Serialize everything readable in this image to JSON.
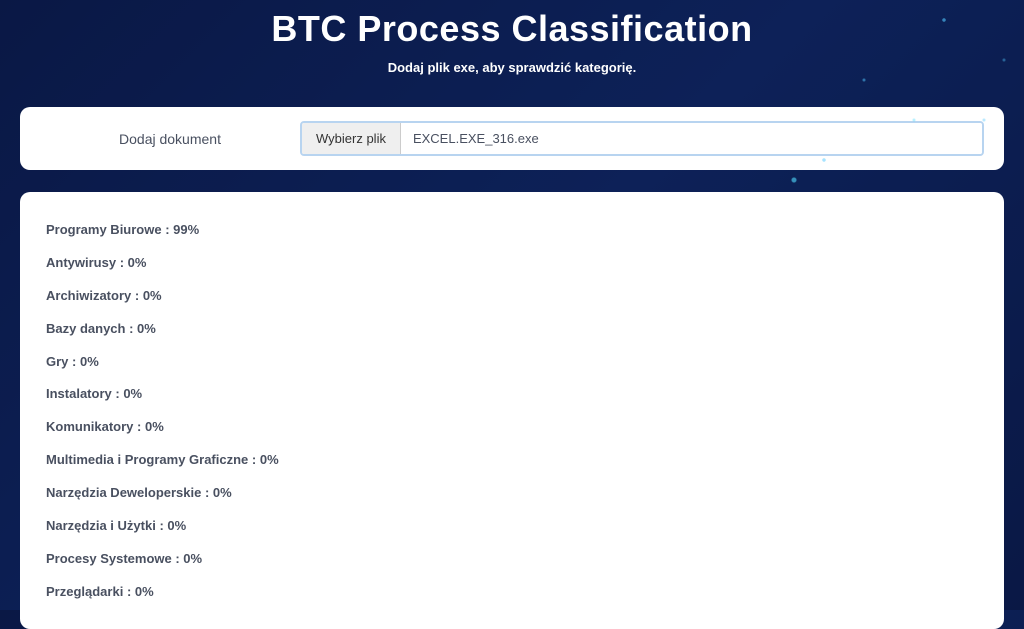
{
  "header": {
    "title": "BTC Process Classification",
    "subtitle": "Dodaj plik exe, aby sprawdzić kategorię."
  },
  "upload": {
    "label": "Dodaj dokument",
    "button": "Wybierz plik",
    "filename": "EXCEL.EXE_316.exe"
  },
  "results": [
    {
      "category": "Programy Biurowe",
      "percent": "99%"
    },
    {
      "category": "Antywirusy",
      "percent": "0%"
    },
    {
      "category": "Archiwizatory",
      "percent": "0%"
    },
    {
      "category": "Bazy danych",
      "percent": "0%"
    },
    {
      "category": "Gry",
      "percent": "0%"
    },
    {
      "category": "Instalatory",
      "percent": "0%"
    },
    {
      "category": "Komunikatory",
      "percent": "0%"
    },
    {
      "category": "Multimedia i Programy Graficzne",
      "percent": "0%"
    },
    {
      "category": "Narzędzia Deweloperskie",
      "percent": "0%"
    },
    {
      "category": "Narzędzia i Użytki",
      "percent": "0%"
    },
    {
      "category": "Procesy Systemowe",
      "percent": "0%"
    },
    {
      "category": "Przeglądarki",
      "percent": "0%"
    }
  ]
}
